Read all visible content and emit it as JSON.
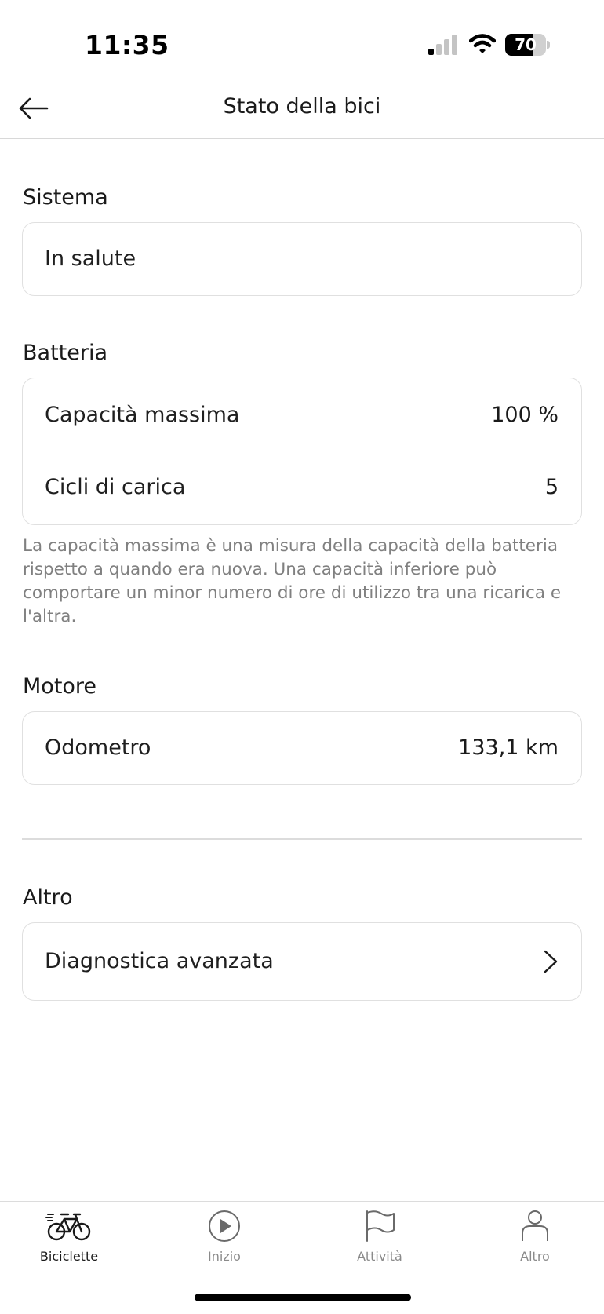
{
  "status_bar": {
    "time": "11:35",
    "battery_level": "70",
    "battery_fraction": 0.7
  },
  "header": {
    "title": "Stato della bici",
    "back_icon": "arrow-left-icon"
  },
  "sections": {
    "sistema": {
      "title": "Sistema",
      "value": "In salute"
    },
    "batteria": {
      "title": "Batteria",
      "rows": [
        {
          "label": "Capacità massima",
          "value": "100 %"
        },
        {
          "label": "Cicli di carica",
          "value": "5"
        }
      ],
      "note": "La capacità massima è una misura della capacità della batteria rispetto a quando era nuova. Una capacità inferiore può comportare un minor numero di ore di utilizzo tra una ricarica e l'altra."
    },
    "motore": {
      "title": "Motore",
      "rows": [
        {
          "label": "Odometro",
          "value": "133,1 km"
        }
      ]
    },
    "altro": {
      "title": "Altro",
      "item_label": "Diagnostica avanzata",
      "item_icon": "chevron-right-icon"
    }
  },
  "tab_bar": {
    "tabs": [
      {
        "label": "Biciclette",
        "icon": "bicycle-icon",
        "active": true
      },
      {
        "label": "Inizio",
        "icon": "play-circle-icon",
        "active": false
      },
      {
        "label": "Attività",
        "icon": "flag-icon",
        "active": false
      },
      {
        "label": "Altro",
        "icon": "person-icon",
        "active": false
      }
    ]
  },
  "colors": {
    "text": "#1a1a1a",
    "muted": "#808080",
    "border": "#e0e0e0",
    "background": "#ffffff"
  }
}
